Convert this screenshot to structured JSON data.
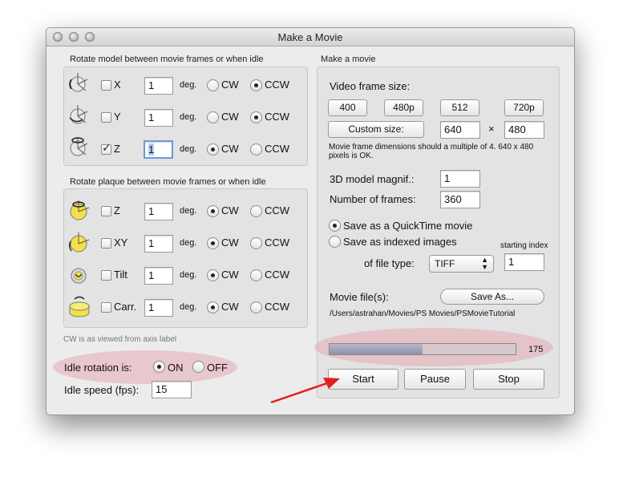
{
  "window": {
    "title": "Make a Movie"
  },
  "left": {
    "rotate_model": {
      "label": "Rotate model between movie frames or when idle",
      "rows": [
        {
          "axis": "X",
          "checked": false,
          "deg": "1",
          "direction": "CCW"
        },
        {
          "axis": "Y",
          "checked": false,
          "deg": "1",
          "direction": "CCW"
        },
        {
          "axis": "Z",
          "checked": true,
          "deg": "1",
          "direction": "CW"
        }
      ]
    },
    "rotate_plaque": {
      "label": "Rotate plaque between movie frames or when idle",
      "rows": [
        {
          "axis": "Z",
          "checked": false,
          "deg": "1",
          "direction": "CW"
        },
        {
          "axis": "XY",
          "checked": false,
          "deg": "1",
          "direction": "CW"
        },
        {
          "axis": "Tilt",
          "checked": false,
          "deg": "1",
          "direction": "CW"
        },
        {
          "axis": "Carr.",
          "checked": false,
          "deg": "1",
          "direction": "CW"
        }
      ]
    },
    "deg_label": "deg.",
    "cw_label": "CW",
    "ccw_label": "CCW",
    "cw_note": "CW is as viewed from axis label",
    "idle_rotation_label": "Idle rotation is:",
    "idle_on_label": "ON",
    "idle_off_label": "OFF",
    "idle_state": "ON",
    "idle_speed_label": "Idle speed (fps):",
    "idle_speed_value": "15"
  },
  "right": {
    "label": "Make a movie",
    "video_frame_size_label": "Video frame size:",
    "preset_buttons": [
      "400",
      "480p",
      "512",
      "720p"
    ],
    "custom_size_button": "Custom size:",
    "width_value": "640",
    "times_symbol": "×",
    "height_value": "480",
    "frame_note_line1": "Movie frame dimensions should a multiple of 4. 640 x 480",
    "frame_note_line2": "pixels is OK.",
    "magnif_label": "3D model magnif.:",
    "magnif_value": "1",
    "frames_label": "Number of frames:",
    "frames_value": "360",
    "save_quicktime_label": "Save as a QuickTime movie",
    "save_images_label": "Save as indexed images",
    "save_mode": "quicktime",
    "starting_index_label": "starting index",
    "starting_index_value": "1",
    "file_type_label": "of file type:",
    "file_type_value": "TIFF",
    "movie_files_label": "Movie file(s):",
    "save_as_button": "Save As...",
    "file_path": "/Users/astrahan/Movies/PS Movies/PSMovieTutorial",
    "progress": {
      "fraction": 0.5,
      "count": "175"
    },
    "start_button": "Start",
    "pause_button": "Pause",
    "stop_button": "Stop"
  },
  "colors": {
    "highlight": "#e6aab4",
    "arrow": "#e0201b",
    "progress_fill": "#9ea0b4",
    "focus": "#6e9ad8"
  }
}
